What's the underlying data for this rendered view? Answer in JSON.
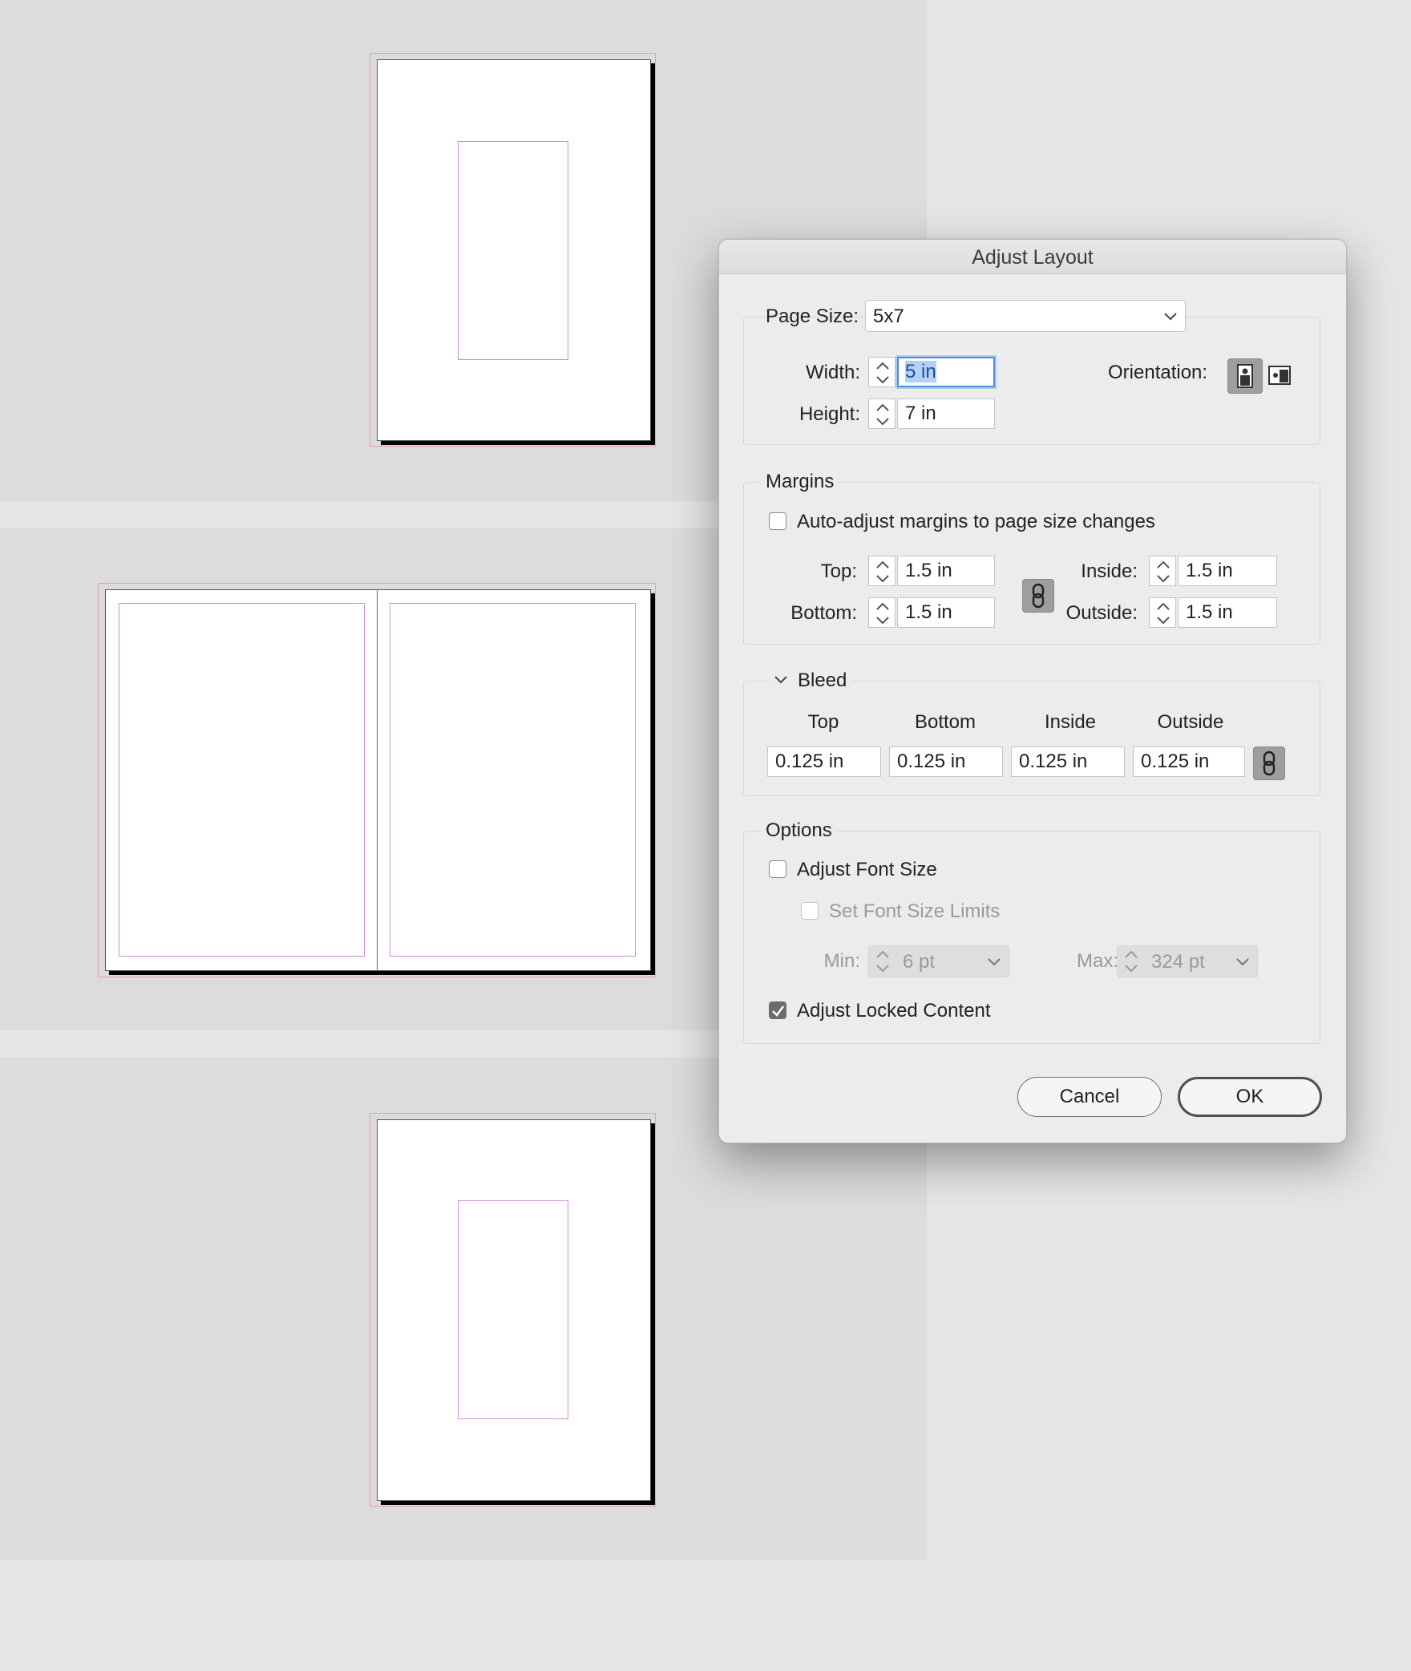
{
  "dialog": {
    "title": "Adjust Layout",
    "page_size": {
      "label": "Page Size:",
      "value": "5x7",
      "width_label": "Width:",
      "width_value": "5 in",
      "height_label": "Height:",
      "height_value": "7 in",
      "orientation_label": "Orientation:"
    },
    "margins": {
      "legend": "Margins",
      "auto_adjust_label": "Auto-adjust margins to page size changes",
      "auto_adjust_checked": false,
      "top_label": "Top:",
      "top_value": "1.5 in",
      "bottom_label": "Bottom:",
      "bottom_value": "1.5 in",
      "inside_label": "Inside:",
      "inside_value": "1.5 in",
      "outside_label": "Outside:",
      "outside_value": "1.5 in"
    },
    "bleed": {
      "legend": "Bleed",
      "columns": [
        "Top",
        "Bottom",
        "Inside",
        "Outside"
      ],
      "values": [
        "0.125 in",
        "0.125 in",
        "0.125 in",
        "0.125 in"
      ]
    },
    "options": {
      "legend": "Options",
      "adjust_font_size_label": "Adjust Font Size",
      "adjust_font_size_checked": false,
      "set_font_limits_label": "Set Font Size Limits",
      "set_font_limits_checked": false,
      "min_label": "Min:",
      "min_value": "6 pt",
      "max_label": "Max:",
      "max_value": "324 pt",
      "adjust_locked_label": "Adjust Locked Content",
      "adjust_locked_checked": true
    },
    "buttons": {
      "cancel": "Cancel",
      "ok": "OK"
    }
  },
  "colors": {
    "focus": "#4c8ee0",
    "bleed_guide": "#e8a0b0",
    "margin_guide": "#d48ad8",
    "pasteboard": "#dcdcdc"
  }
}
